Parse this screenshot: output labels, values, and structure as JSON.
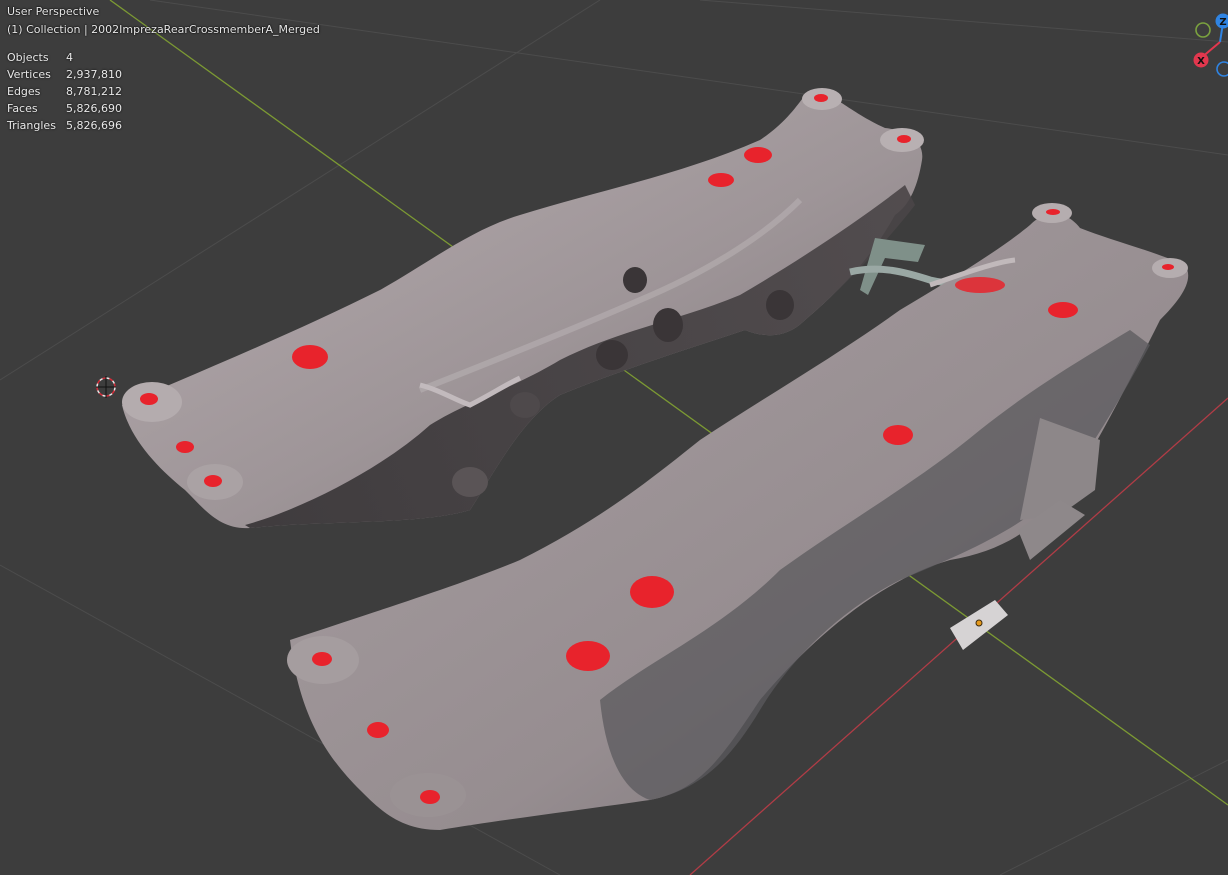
{
  "viewport": {
    "title": "User Perspective",
    "subtitle": "(1) Collection | 2002ImprezaRearCrossmemberA_Merged"
  },
  "stats": [
    {
      "label": "Objects",
      "value": "4"
    },
    {
      "label": "Vertices",
      "value": "2,937,810"
    },
    {
      "label": "Edges",
      "value": "8,781,212"
    },
    {
      "label": "Faces",
      "value": "5,826,690"
    },
    {
      "label": "Triangles",
      "value": "5,826,696"
    }
  ],
  "gizmo": {
    "z_label": "Z",
    "x_label": "X",
    "colors": {
      "z": "#2f84e3",
      "x": "#e2374e",
      "y": "#7ba23f"
    }
  },
  "colors": {
    "background": "#3d3d3d",
    "x_axis": "#b03c46",
    "y_axis": "#7c9a33",
    "mesh": "#a29a9c",
    "mesh_shadow": "#2e2c2e",
    "hole_red": "#e8232c"
  }
}
